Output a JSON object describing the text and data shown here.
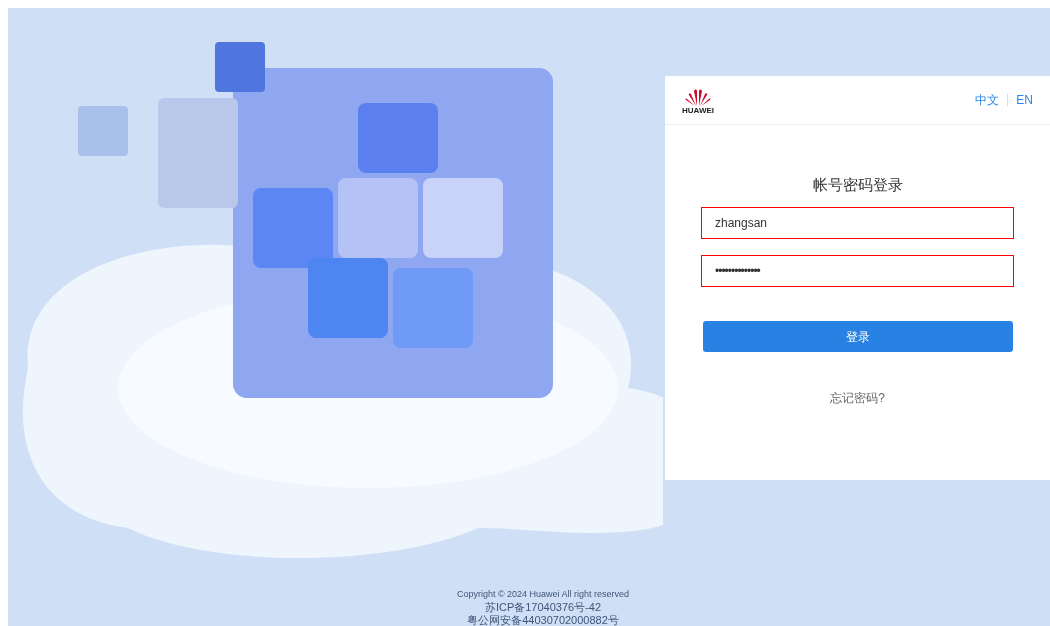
{
  "login_card": {
    "logo_text": "HUAWEI",
    "languages": [
      {
        "label": "中文"
      },
      {
        "label": "EN"
      }
    ],
    "title": "帐号密码登录",
    "fields": [
      {
        "kind": "text",
        "value": "zhangsan",
        "invalid": true
      },
      {
        "kind": "password",
        "value": "••••••••••••••",
        "invalid": true
      }
    ],
    "submit_button": "登录",
    "forgot_link": "忘记密码?"
  },
  "footer": [
    "Copyright © 2024 Huawei All right reserved",
    "苏ICP备17040376号-42",
    "粤公网安备44030702000882号"
  ]
}
